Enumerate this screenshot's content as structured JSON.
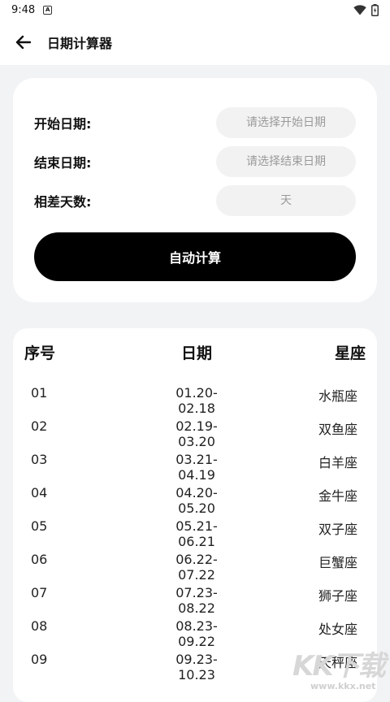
{
  "status_bar": {
    "time": "9:48",
    "notification_glyph": "A"
  },
  "header": {
    "title": "日期计算器"
  },
  "form": {
    "start": {
      "label": "开始日期:",
      "placeholder": "请选择开始日期"
    },
    "end": {
      "label": "结束日期:",
      "placeholder": "请选择结束日期"
    },
    "diff": {
      "label": "相差天数:",
      "placeholder": "天"
    },
    "button_label": "自动计算"
  },
  "table": {
    "headers": [
      "序号",
      "日期",
      "星座"
    ],
    "rows": [
      [
        "01",
        "01.20-02.18",
        "水瓶座"
      ],
      [
        "02",
        "02.19-03.20",
        "双鱼座"
      ],
      [
        "03",
        "03.21-04.19",
        "白羊座"
      ],
      [
        "04",
        "04.20-05.20",
        "金牛座"
      ],
      [
        "05",
        "05.21-06.21",
        "双子座"
      ],
      [
        "06",
        "06.22-07.22",
        "巨蟹座"
      ],
      [
        "07",
        "07.23-08.22",
        "狮子座"
      ],
      [
        "08",
        "08.23-09.22",
        "处女座"
      ],
      [
        "09",
        "09.23-10.23",
        "天秤座"
      ]
    ]
  },
  "watermark": {
    "logo_text": "KK下载",
    "url": "www.kkx.net"
  },
  "colors": {
    "background": "#f2f3f5",
    "card": "#ffffff",
    "button": "#000000",
    "field": "#f2f2f2"
  },
  "icons": [
    "back-arrow-icon",
    "wifi-icon",
    "battery-icon",
    "notification-icon"
  ]
}
